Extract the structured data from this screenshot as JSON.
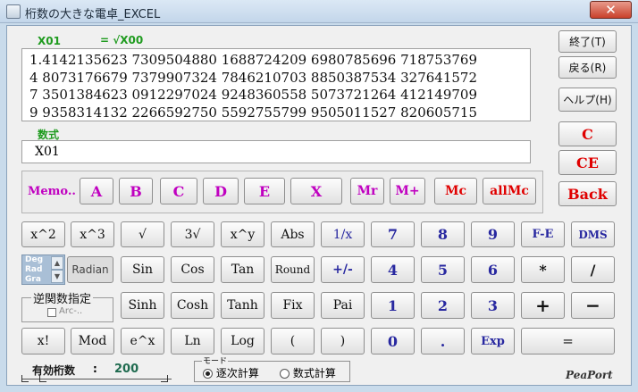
{
  "window": {
    "title": "桁数の大きな電卓_EXCEL",
    "close_glyph": "✕"
  },
  "display": {
    "var_label": "X01",
    "expr_label": "= √X00",
    "lines": [
      "1.4142135623 7309504880 1688724209 6980785696 718753769",
      "4 8073176679 7379907324 7846210703 8850387534 327641572",
      "7 3501384623 0912297024 9248360558 5073721264 412149709",
      "9 9358314132 2266592750 5592755799 9505011527 820605715"
    ]
  },
  "formula": {
    "label": "数式",
    "value": "X01"
  },
  "side_buttons": {
    "exit": "終了(T)",
    "back": "戻る(R)",
    "help": "ヘルプ(H)",
    "c": "C",
    "ce": "CE",
    "backspace": "Back"
  },
  "memory_row": {
    "memo": "Memo..",
    "a": "A",
    "b": "B",
    "c": "C",
    "d": "D",
    "e": "E",
    "x": "X",
    "mr": "Mr",
    "mplus": "M+",
    "mc": "Mc",
    "allmc": "allMc"
  },
  "keys": {
    "row1": [
      "x^2",
      "x^3",
      "√",
      "3√",
      "x^y",
      "Abs",
      "1/x",
      "7",
      "8",
      "9",
      "F-E",
      "DMS"
    ],
    "row2": [
      "Sin",
      "Cos",
      "Tan",
      "Round",
      "+/-",
      "4",
      "5",
      "6",
      "*",
      "/"
    ],
    "row3": [
      "Sinh",
      "Cosh",
      "Tanh",
      "Fix",
      "Pai",
      "1",
      "2",
      "3",
      "+",
      "−"
    ],
    "row4": [
      "x!",
      "Mod",
      "e^x",
      "Ln",
      "Log",
      "(",
      ")",
      "0",
      ".",
      "Exp",
      "="
    ]
  },
  "angle": {
    "deg": "Deg",
    "rad": "Rad",
    "gra": "Gra",
    "button": "Radian"
  },
  "inverse": {
    "group_label": "逆関数指定",
    "checkbox_label": "Arc-..",
    "checked": false
  },
  "precision": {
    "label": "有効桁数",
    "colon": ":",
    "value": "200"
  },
  "mode": {
    "group_label": "モード",
    "options": [
      "逐次計算",
      "数式計算"
    ],
    "selected": "逐次計算"
  },
  "brand": "PeaPort",
  "colors": {
    "green_label": "#1f9b1f",
    "memory_pink": "#c000c0",
    "alert_red": "#e00000",
    "func_blue": "#2828a0"
  }
}
